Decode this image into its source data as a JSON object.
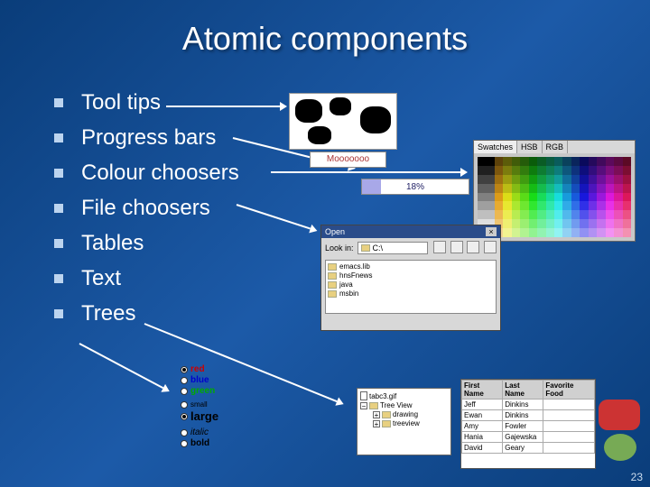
{
  "title": "Atomic components",
  "bullets": [
    "Tool tips",
    "Progress bars",
    "Colour choosers",
    "File choosers",
    "Tables",
    "Text",
    "Trees"
  ],
  "tooltip_text": "Mooooooo",
  "progress": {
    "label": "18%"
  },
  "swatches_tabs": [
    "Swatches",
    "HSB",
    "RGB"
  ],
  "file_chooser": {
    "title": "Open",
    "lookin_label": "Look in:",
    "lookin_value": "C:\\",
    "items": [
      "emacs.lib",
      "hnsFnews",
      "java",
      "msbin"
    ]
  },
  "text_options": {
    "colors": [
      {
        "label": "red",
        "css": "#c00"
      },
      {
        "label": "blue",
        "css": "#00c"
      },
      {
        "label": "green",
        "css": "#0a0"
      }
    ],
    "sizes": [
      "small",
      "large"
    ],
    "styles": [
      "italic",
      "bold"
    ]
  },
  "tree": {
    "items": [
      {
        "label": "tabc3.gif",
        "kind": "file"
      },
      {
        "label": "Tree View",
        "kind": "folder",
        "expanded": true
      },
      {
        "label": "drawing",
        "kind": "folder",
        "indent": 1
      },
      {
        "label": "treeview",
        "kind": "folder",
        "indent": 1
      }
    ]
  },
  "table": {
    "headers": [
      "First Name",
      "Last Name",
      "Favorite Food"
    ],
    "rows": [
      [
        "Jeff",
        "Dinkins",
        ""
      ],
      [
        "Ewan",
        "Dinkins",
        ""
      ],
      [
        "Amy",
        "Fowler",
        ""
      ],
      [
        "Hania",
        "Gajewska",
        ""
      ],
      [
        "David",
        "Geary",
        ""
      ]
    ]
  },
  "slide_number": "23"
}
